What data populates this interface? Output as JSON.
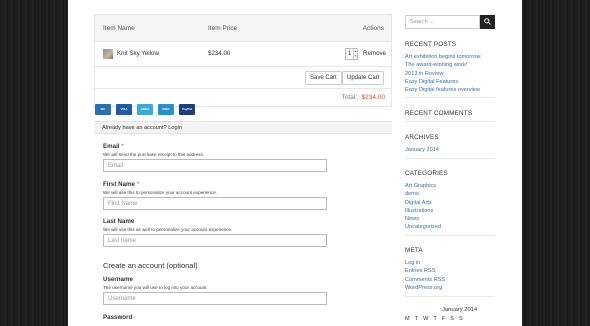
{
  "cart": {
    "headers": {
      "item_name": "Item Name",
      "item_price": "Item Price",
      "actions": "Actions"
    },
    "items": [
      {
        "name": "Knit Sky Yellow",
        "price": "$234.00",
        "qty": "1",
        "remove": "Remove"
      }
    ],
    "save_cart": "Save Cart",
    "update_cart": "Update Cart",
    "total_label": "Total:",
    "total_value": "$234.00"
  },
  "payment_cards": [
    {
      "name": "mastercard-icon",
      "label": "MC",
      "color": "#2a6fb0"
    },
    {
      "name": "visa-icon",
      "label": "VISA",
      "color": "#1f5aa6"
    },
    {
      "name": "amex-icon",
      "label": "AMEX",
      "color": "#3ea9d8"
    },
    {
      "name": "discover-icon",
      "label": "DISC",
      "color": "#2b8ccf"
    },
    {
      "name": "paypal-icon",
      "label": "PayPal",
      "color": "#1a3f7a"
    }
  ],
  "login": {
    "prompt": "Already have an account?",
    "link": "Login"
  },
  "form": {
    "email": {
      "label": "Email",
      "required": "*",
      "desc": "We will send the purchase receipt to this address.",
      "placeholder": "Email"
    },
    "first_name": {
      "label": "First Name",
      "required": "*",
      "desc": "We will use this to personalize your account experience.",
      "placeholder": "First Name"
    },
    "last_name": {
      "label": "Last Name",
      "desc": "We will use this as well to personalize your account experience.",
      "placeholder": "Last name"
    },
    "create_title": "Create an account (optional)",
    "username": {
      "label": "Username",
      "desc": "The username you will use to log into your account.",
      "placeholder": "Username"
    },
    "password": {
      "label": "Password"
    }
  },
  "sidebar": {
    "search_placeholder": "Search ...",
    "recent_posts": {
      "title": "RECENT POSTS",
      "items": [
        "Art exhibition begins tomorrow.",
        "The award-winning work!",
        "2013 in Review",
        "Easy Digital Features",
        "Easy Digital features overview"
      ]
    },
    "recent_comments": {
      "title": "RECENT COMMENTS"
    },
    "archives": {
      "title": "ARCHIVES",
      "items": [
        "January 2014"
      ]
    },
    "categories": {
      "title": "CATEGORIES",
      "items": [
        "Art Graphics",
        "demo",
        "Digital Arts",
        "Illustrations",
        "News",
        "Uncategorized"
      ]
    },
    "meta": {
      "title": "META",
      "items": [
        "Log in",
        "Entries RSS",
        "Comments RSS",
        "WordPress.org"
      ]
    },
    "calendar": {
      "title": "January 2014",
      "days": [
        "M",
        "T",
        "W",
        "T",
        "F",
        "S",
        "S"
      ]
    }
  }
}
